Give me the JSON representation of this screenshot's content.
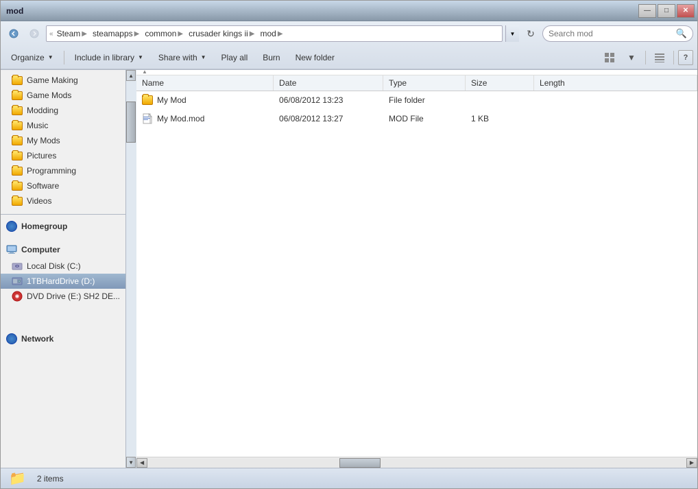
{
  "window": {
    "title": "mod",
    "min_label": "—",
    "max_label": "□",
    "close_label": "✕"
  },
  "nav": {
    "back_disabled": false,
    "forward_disabled": true,
    "breadcrumb": [
      "Steam",
      "steamapps",
      "common",
      "crusader kings ii",
      "mod"
    ],
    "search_placeholder": "Search mod",
    "refresh_label": "↻"
  },
  "toolbar": {
    "organize_label": "Organize",
    "include_label": "Include in library",
    "share_label": "Share with",
    "play_label": "Play all",
    "burn_label": "Burn",
    "new_folder_label": "New folder",
    "help_label": "?"
  },
  "columns": {
    "name": "Name",
    "date": "Date",
    "type": "Type",
    "size": "Size",
    "length": "Length"
  },
  "files": [
    {
      "name": "My Mod",
      "date": "06/08/2012 13:23",
      "type": "File folder",
      "size": "",
      "length": "",
      "icon_type": "folder"
    },
    {
      "name": "My Mod.mod",
      "date": "06/08/2012 13:27",
      "type": "MOD File",
      "size": "1 KB",
      "length": "",
      "icon_type": "mod"
    }
  ],
  "sidebar": {
    "favorites": [
      {
        "label": "Game Making",
        "icon": "folder"
      },
      {
        "label": "Game Mods",
        "icon": "folder"
      },
      {
        "label": "Modding",
        "icon": "folder"
      },
      {
        "label": "Music",
        "icon": "folder"
      },
      {
        "label": "My Mods",
        "icon": "folder"
      },
      {
        "label": "Pictures",
        "icon": "folder"
      },
      {
        "label": "Programming",
        "icon": "folder"
      },
      {
        "label": "Software",
        "icon": "folder"
      },
      {
        "label": "Videos",
        "icon": "folder"
      }
    ],
    "homegroup": {
      "label": "Homegroup",
      "icon": "globe"
    },
    "computer": {
      "label": "Computer",
      "drives": [
        {
          "label": "Local Disk (C:)",
          "icon": "drive"
        },
        {
          "label": "1TBHardDrive (D:)",
          "icon": "drive",
          "selected": true
        },
        {
          "label": "DVD Drive (E:) SH2 DE...",
          "icon": "dvd"
        }
      ]
    },
    "network": {
      "label": "Network",
      "icon": "globe"
    }
  },
  "status": {
    "item_count": "2 items"
  }
}
